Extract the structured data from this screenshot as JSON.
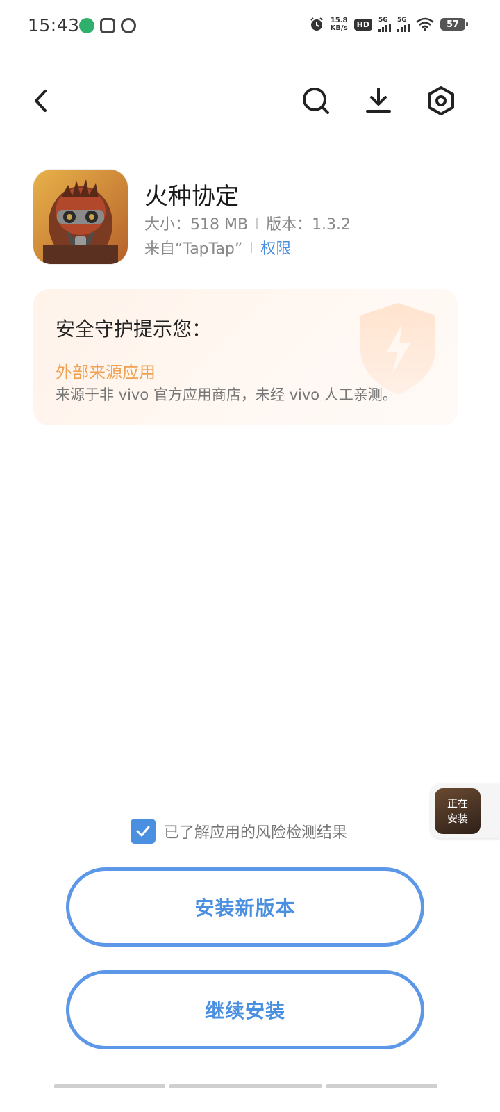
{
  "status_bar": {
    "time": "15:43",
    "net_speed_value": "15.8",
    "net_speed_unit": "KB/s",
    "hd_label": "HD",
    "sim1_label": "5G",
    "sim2_label": "5G",
    "battery": "57"
  },
  "toolbar": {
    "back_icon": "chevron-left",
    "search_icon": "search",
    "download_icon": "download",
    "settings_icon": "hex-settings"
  },
  "app": {
    "name": "火种协定",
    "size_label": "大小：518 MB",
    "version_label": "版本：1.3.2",
    "source_label": "来自“TapTap”",
    "permissions_link": "权限"
  },
  "security": {
    "title": "安全守护提示您：",
    "warning": "外部来源应用",
    "description": "来源于非 vivo 官方应用商店，未经 vivo 人工亲测。"
  },
  "floating": {
    "line1": "正在",
    "line2": "安装"
  },
  "consent": {
    "checked": true,
    "label": "已了解应用的风险检测结果"
  },
  "buttons": {
    "install_new": "安装新版本",
    "continue_install": "继续安装"
  },
  "colors": {
    "accent": "#4a8fe0",
    "warning": "#f0a050",
    "card_bg": "#fff3ea"
  }
}
